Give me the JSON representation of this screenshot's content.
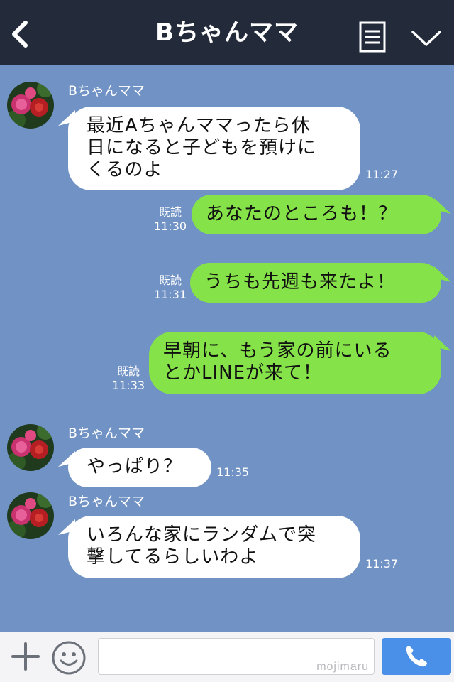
{
  "header": {
    "title": "Bちゃんママ",
    "back_icon": "chevron-left-icon",
    "notes_icon": "notes-icon",
    "menu_icon": "chevron-down-icon"
  },
  "messages": [
    {
      "direction": "incoming",
      "sender": "Bちゃんママ",
      "text": "最近Aちゃんママったら休\n日になると子どもを預けに\nくるのよ",
      "time": "11:27"
    },
    {
      "direction": "outgoing",
      "read": "既読",
      "text": "あなたのところも！？",
      "time": "11:30"
    },
    {
      "direction": "outgoing",
      "read": "既読",
      "text": "うちも先週も来たよ！",
      "time": "11:31"
    },
    {
      "direction": "outgoing",
      "read": "既読",
      "text": "早朝に、もう家の前にいる\nとかLINEが来て！",
      "time": "11:33"
    },
    {
      "direction": "incoming",
      "sender": "Bちゃんママ",
      "text": "やっぱり？",
      "time": "11:35"
    },
    {
      "direction": "incoming",
      "sender": "Bちゃんママ",
      "text": "いろんな家にランダムで突\n撃してるらしいわよ",
      "time": "11:37"
    }
  ],
  "input": {
    "value": "",
    "watermark": "mojimaru"
  },
  "colors": {
    "header_bg": "#232b3b",
    "chat_bg": "#7092c4",
    "outgoing_bubble": "#85e249",
    "incoming_bubble": "#ffffff",
    "send_button": "#4a8fe8"
  }
}
